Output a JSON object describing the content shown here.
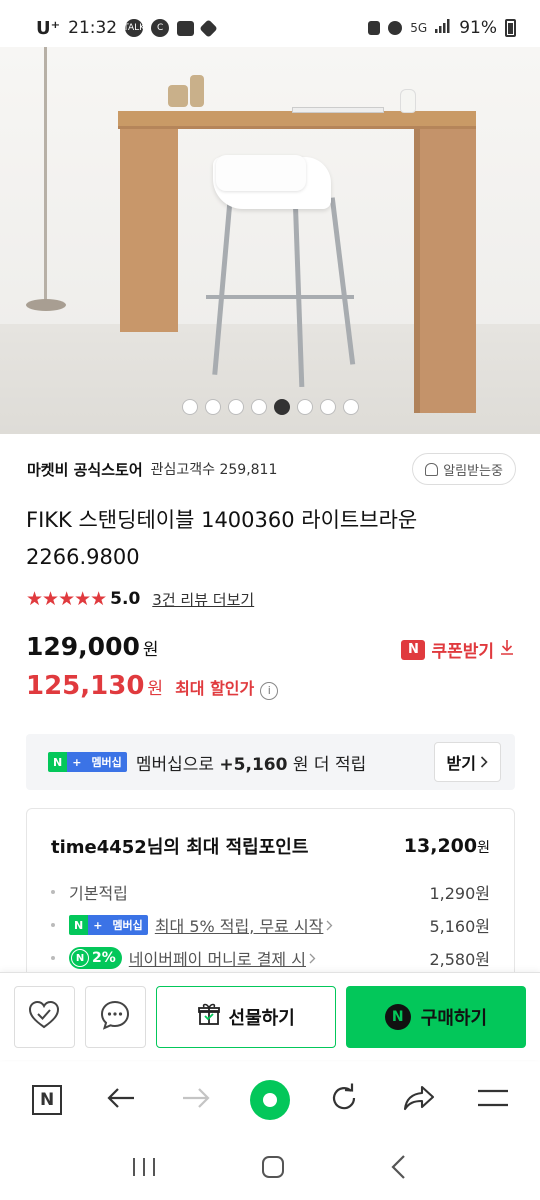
{
  "status_bar": {
    "carrier": "U⁺",
    "time": "21:32",
    "talk_icon_text": "TALK",
    "c_icon_text": "C",
    "network": "5G",
    "battery": "91%"
  },
  "gallery": {
    "dot_count": 8,
    "active_index": 4
  },
  "store": {
    "name": "마켓비 공식스토어",
    "fans": "관심고객수 259,811",
    "alert_button": "알림받는중"
  },
  "product": {
    "title": "FIKK 스탠딩테이블 1400360 라이트브라운 2266.9800",
    "stars": "★★★★★",
    "rating": "5.0",
    "reviews_link": "3건 리뷰 더보기",
    "price": "129,000",
    "price_unit": "원",
    "coupon_label": "쿠폰받기",
    "coupon_badge": "N",
    "sale_price": "125,130",
    "sale_unit": "원",
    "sale_label": "최대 할인가"
  },
  "membership": {
    "badge_n": "N",
    "badge_plus": "+",
    "badge_text": "멤버십",
    "text_prefix": "멤버십으로 ",
    "amount": "+5,160",
    "text_suffix": "원 더 적립",
    "button": "받기"
  },
  "points": {
    "title": "time4452님의 최대 적립포인트",
    "total": "13,200",
    "total_unit": "원",
    "rows": [
      {
        "label": "기본적립",
        "value": "1,290원"
      },
      {
        "label": "최대 5% 적립, 무료 시작",
        "value": "5,160원"
      },
      {
        "badge": "2%",
        "label": "네이버페이 머니로 결제 시",
        "value": "2,580원"
      }
    ]
  },
  "actions": {
    "gift": "선물하기",
    "buy": "구매하기",
    "buy_badge": "N"
  },
  "browser": {
    "home_letter": "N"
  }
}
